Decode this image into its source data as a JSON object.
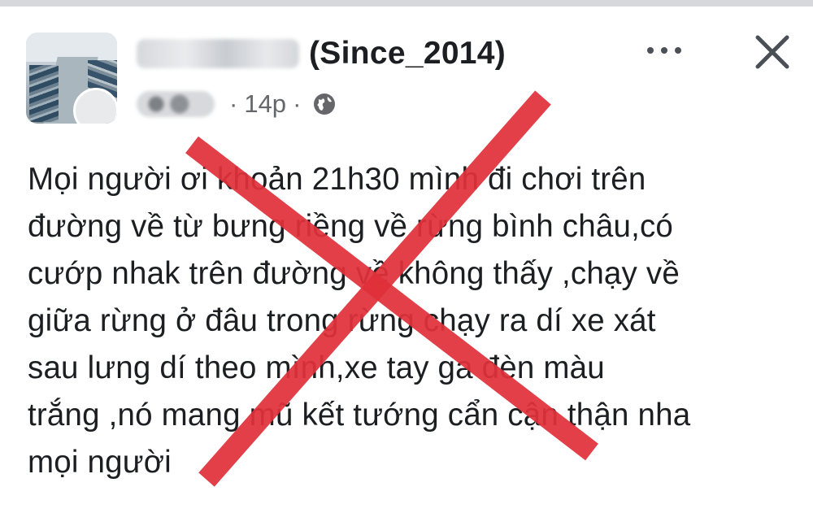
{
  "post": {
    "page_name": "(Since_2014)",
    "timestamp": "14p",
    "separator": "·",
    "privacy_icon": "globe-icon",
    "more_icon": "more-options-icon",
    "close_icon": "close-icon",
    "lines": [
      "Mọi người ơi khoản 21h30 mình đi chơi trên",
      "đường về từ bưng riềng về rừng bình châu,có",
      "cướp nhak trên đường về không thấy ,chạy về",
      "giữa rừng ở  đâu trong rừng chạy ra dí xe xát",
      "sau lưng dí theo mình,xe tay ga đèn màu",
      "trắng ,nó mang mũ kết tướng cẩn cận thận nha",
      "mọi người"
    ]
  },
  "overlay": {
    "type": "red-x-mark",
    "color": "#e0313b"
  }
}
